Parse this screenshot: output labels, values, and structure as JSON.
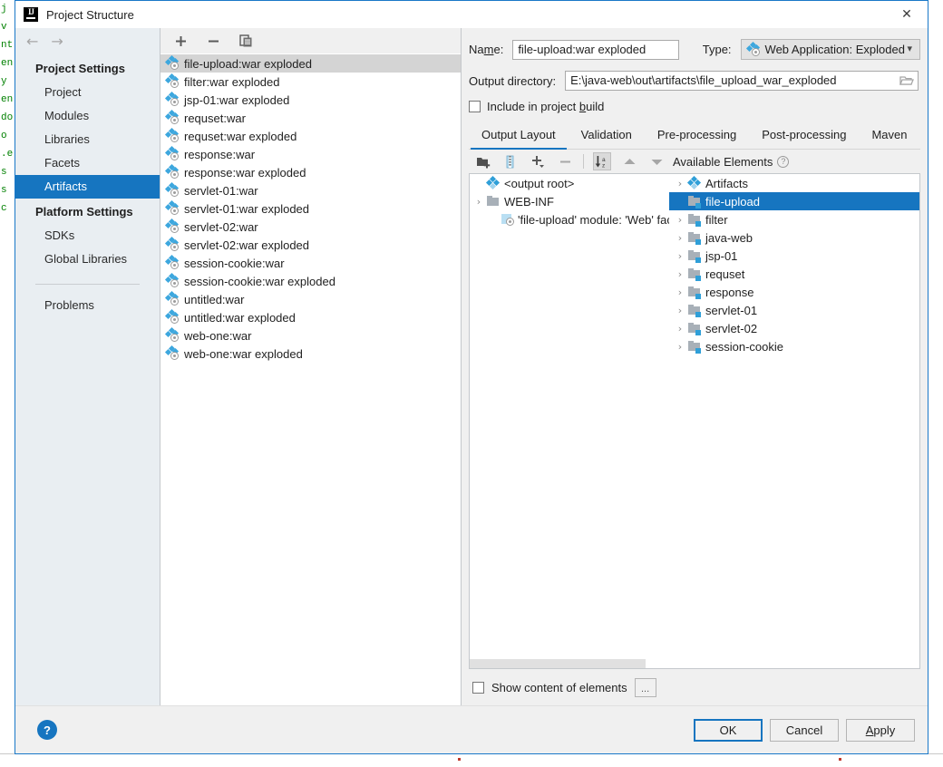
{
  "window": {
    "title": "Project Structure",
    "logo_icon": "intellij-idea-logo",
    "close_icon": "close-icon"
  },
  "sidebar": {
    "back_icon": "arrow-left-icon",
    "forward_icon": "arrow-right-icon",
    "groups": [
      {
        "label": "Project Settings",
        "items": [
          {
            "label": "Project",
            "selected": false
          },
          {
            "label": "Modules",
            "selected": false
          },
          {
            "label": "Libraries",
            "selected": false
          },
          {
            "label": "Facets",
            "selected": false
          },
          {
            "label": "Artifacts",
            "selected": true
          }
        ]
      },
      {
        "label": "Platform Settings",
        "items": [
          {
            "label": "SDKs",
            "selected": false
          },
          {
            "label": "Global Libraries",
            "selected": false
          }
        ]
      }
    ],
    "problems_label": "Problems"
  },
  "artifacts_panel": {
    "toolbar": [
      {
        "name": "add-artifact-button",
        "glyph": "+"
      },
      {
        "name": "remove-artifact-button",
        "glyph": "−"
      },
      {
        "name": "copy-artifact-button",
        "glyph": "copy-icon"
      }
    ],
    "items": [
      {
        "label": "file-upload:war exploded",
        "selected": true
      },
      {
        "label": "filter:war exploded",
        "selected": false
      },
      {
        "label": "jsp-01:war exploded",
        "selected": false
      },
      {
        "label": "requset:war",
        "selected": false
      },
      {
        "label": "requset:war exploded",
        "selected": false
      },
      {
        "label": "response:war",
        "selected": false
      },
      {
        "label": "response:war exploded",
        "selected": false
      },
      {
        "label": "servlet-01:war",
        "selected": false
      },
      {
        "label": "servlet-01:war exploded",
        "selected": false
      },
      {
        "label": "servlet-02:war",
        "selected": false
      },
      {
        "label": "servlet-02:war exploded",
        "selected": false
      },
      {
        "label": "session-cookie:war",
        "selected": false
      },
      {
        "label": "session-cookie:war exploded",
        "selected": false
      },
      {
        "label": "untitled:war",
        "selected": false
      },
      {
        "label": "untitled:war exploded",
        "selected": false
      },
      {
        "label": "web-one:war",
        "selected": false
      },
      {
        "label": "web-one:war exploded",
        "selected": false
      }
    ]
  },
  "details": {
    "name_label": "Name:",
    "name_value": "file-upload:war exploded",
    "type_label": "Type:",
    "type_value": "Web Application: Exploded",
    "type_icon": "artifact-icon",
    "output_dir_label": "Output directory:",
    "output_dir_value": "E:\\java-web\\out\\artifacts\\file_upload_war_exploded",
    "browse_icon": "folder-open-icon",
    "include_in_build_label": "Include in project build",
    "include_in_build_checked": false
  },
  "tabs": [
    {
      "label": "Output Layout",
      "active": true
    },
    {
      "label": "Validation",
      "active": false
    },
    {
      "label": "Pre-processing",
      "active": false
    },
    {
      "label": "Post-processing",
      "active": false
    },
    {
      "label": "Maven",
      "active": false
    }
  ],
  "output_layout": {
    "toolbar": [
      {
        "name": "create-directory-button",
        "glyph": "folder-plus-icon"
      },
      {
        "name": "create-archive-button",
        "glyph": "archive-icon"
      },
      {
        "name": "add-copy-of-button",
        "glyph": "+"
      },
      {
        "name": "remove-element-button",
        "glyph": "−"
      },
      {
        "name": "sort-alphabetically-button",
        "glyph": "sort-az-icon",
        "pressed": true
      },
      {
        "name": "move-up-button",
        "glyph": "chevron-up-icon"
      },
      {
        "name": "move-down-button",
        "glyph": "chevron-down-icon"
      }
    ],
    "tree": [
      {
        "label": "<output root>",
        "icon": "artifact-icon",
        "indent": 0,
        "twisty": "",
        "selected": false
      },
      {
        "label": "WEB-INF",
        "icon": "folder-icon",
        "indent": 0,
        "twisty": "›",
        "selected": false
      },
      {
        "label": "'file-upload' module: 'Web' facet resource",
        "icon": "facet-resource-icon",
        "indent": 1,
        "twisty": "",
        "selected": false
      }
    ]
  },
  "available_elements": {
    "header": "Available Elements",
    "help_icon": "help-icon",
    "tree": [
      {
        "label": "Artifacts",
        "icon": "artifact-icon",
        "twisty": "›",
        "selected": false
      },
      {
        "label": "file-upload",
        "icon": "module-icon",
        "twisty": "",
        "selected": true
      },
      {
        "label": "filter",
        "icon": "module-icon",
        "twisty": "›",
        "selected": false
      },
      {
        "label": "java-web",
        "icon": "module-icon",
        "twisty": "›",
        "selected": false
      },
      {
        "label": "jsp-01",
        "icon": "module-icon",
        "twisty": "›",
        "selected": false
      },
      {
        "label": "requset",
        "icon": "module-icon",
        "twisty": "›",
        "selected": false
      },
      {
        "label": "response",
        "icon": "module-icon",
        "twisty": "›",
        "selected": false
      },
      {
        "label": "servlet-01",
        "icon": "module-icon",
        "twisty": "›",
        "selected": false
      },
      {
        "label": "servlet-02",
        "icon": "module-icon",
        "twisty": "›",
        "selected": false
      },
      {
        "label": "session-cookie",
        "icon": "module-icon",
        "twisty": "›",
        "selected": false
      }
    ]
  },
  "bottom": {
    "show_content_label": "Show content of elements",
    "show_content_checked": false,
    "ellipsis_button": "..."
  },
  "footer": {
    "help_glyph": "?",
    "ok_label": "OK",
    "cancel_label": "Cancel",
    "apply_label": "Apply"
  },
  "background": {
    "code_fragments": [
      "",
      "j",
      "v",
      "nt",
      "",
      "",
      "en",
      "y .",
      "",
      "en",
      "do",
      "",
      "",
      "",
      "",
      "",
      "",
      "",
      "",
      "",
      "",
      "",
      "",
      "",
      "",
      "",
      "",
      "",
      "",
      "",
      "",
      "",
      "",
      "",
      "",
      "",
      "o",
      ".e",
      "s",
      "s",
      "c"
    ]
  }
}
